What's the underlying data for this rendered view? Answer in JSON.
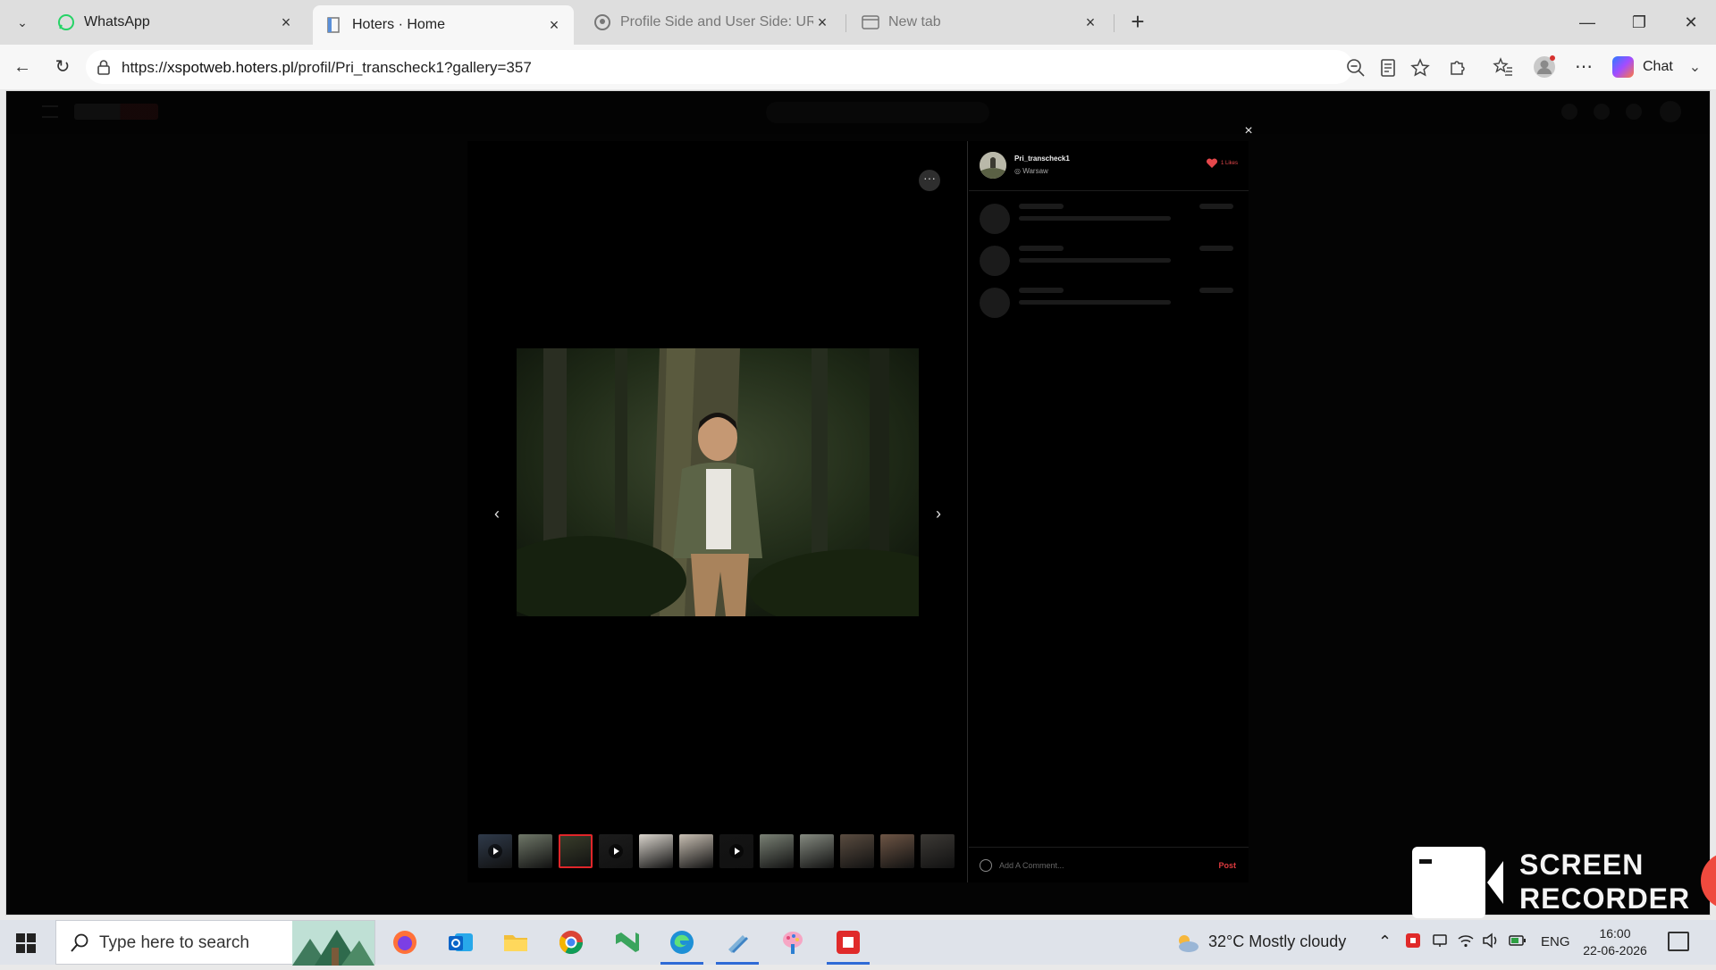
{
  "browser": {
    "tabs": [
      {
        "title": "WhatsApp",
        "icon": "whatsapp-icon",
        "active": false
      },
      {
        "title": "Hoters · Home",
        "icon": "page-icon",
        "active": true
      },
      {
        "title": "Profile Side and User Side: URL iss",
        "icon": "github-icon",
        "active": false
      },
      {
        "title": "New tab",
        "icon": "newtab-icon",
        "active": false
      }
    ],
    "address": {
      "prefix": "https://",
      "host": "xspotweb.hoters.pl",
      "path": "/profil/Pri_transcheck1?gallery=357"
    },
    "chat_label": "Chat"
  },
  "modal": {
    "user": {
      "name": "Pri_transcheck1",
      "location": "Warsaw"
    },
    "likes": "1 Likes",
    "comment_placeholder": "Add A Comment...",
    "post_label": "Post",
    "close_glyph": "×",
    "more_glyph": "···",
    "prev_glyph": "‹",
    "next_glyph": "›",
    "thumbnails": [
      {
        "kind": "video",
        "tone": "#2f3a4a"
      },
      {
        "kind": "photo",
        "tone": "#6f7768"
      },
      {
        "kind": "photo",
        "tone": "#3b3f2c",
        "active": true
      },
      {
        "kind": "video",
        "tone": "#1c1c1c"
      },
      {
        "kind": "photo",
        "tone": "#d9d4cc"
      },
      {
        "kind": "photo",
        "tone": "#c8bfb3"
      },
      {
        "kind": "video",
        "tone": "#141414"
      },
      {
        "kind": "photo",
        "tone": "#7a8175"
      },
      {
        "kind": "photo",
        "tone": "#858a80"
      },
      {
        "kind": "photo",
        "tone": "#5a4c40"
      },
      {
        "kind": "photo",
        "tone": "#6d5545"
      },
      {
        "kind": "photo",
        "tone": "#3d3a36"
      }
    ]
  },
  "recorder": {
    "line1": "SCREEN",
    "line2": "RECORDER"
  },
  "taskbar": {
    "search_placeholder": "Type here to search",
    "weather": "32°C  Mostly cloudy",
    "language": "ENG",
    "time": "16:00",
    "date": "22-06-2026"
  },
  "colors": {
    "accent_red": "#e03a3e",
    "page_bg": "#0b0b0b"
  }
}
